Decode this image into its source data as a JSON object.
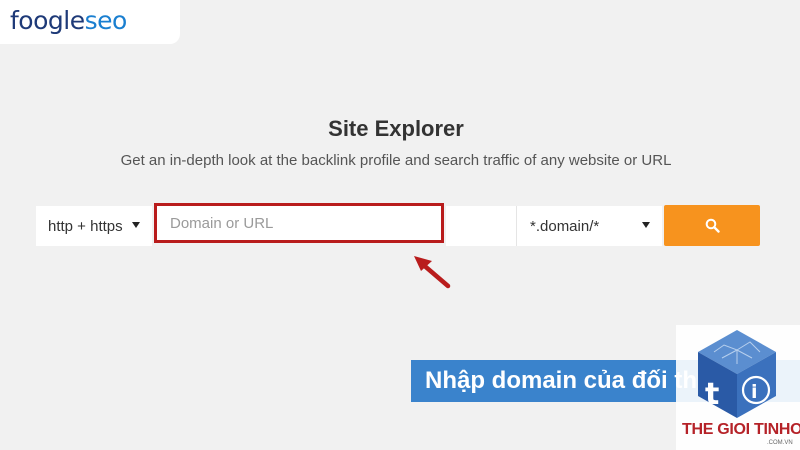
{
  "logo": {
    "part1": "foogle",
    "part2": "seo"
  },
  "header": {
    "title": "Site Explorer",
    "subtitle": "Get an in-depth look at the backlink profile and search traffic of any website or URL"
  },
  "search": {
    "protocol_value": "http + https",
    "placeholder": "Domain or URL",
    "value": "",
    "scope_value": "*.domain/*"
  },
  "colors": {
    "accent": "#f7931e",
    "highlight": "#b91c1c",
    "banner": "#3a83cc",
    "brand": "#1e3a78"
  },
  "icons": {
    "search_button": "search-icon",
    "annotation": "red-arrow-icon"
  },
  "annotation": {
    "caption": "Nhập domain của đối thủ"
  },
  "watermark": {
    "brand": "THE GIOI TINHOC",
    "domain": ".COM.VN"
  }
}
